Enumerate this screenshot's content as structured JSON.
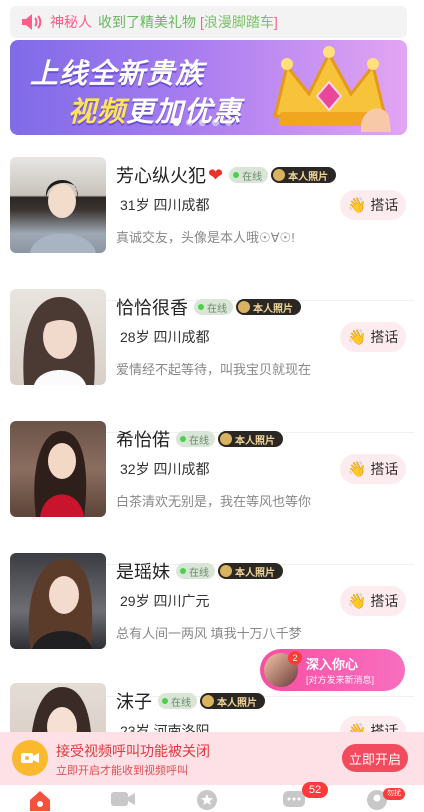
{
  "notice": {
    "icon": "speaker-icon",
    "sender": "神秘人",
    "action": "收到了精美礼物",
    "gift_open": "[",
    "gift": "浪漫脚踏车",
    "gift_close": "]"
  },
  "banner": {
    "line1": "上线全新贵族",
    "line2_highlight": "视频",
    "line2_rest": "更加优惠",
    "dots_count": 5,
    "active_dot": 1
  },
  "badges": {
    "online": "在线",
    "photo": "本人照片"
  },
  "chat_label": "搭话",
  "profiles": [
    {
      "name": "芳心纵火犯",
      "heart": true,
      "age": "31岁",
      "location": "四川成都",
      "bio": "真诚交友，头像是本人哦☉∀☉!"
    },
    {
      "name": "恰恰很香",
      "heart": false,
      "age": "28岁",
      "location": "四川成都",
      "bio": "爱情经不起等待，叫我宝贝就现在"
    },
    {
      "name": "希怡偌",
      "heart": false,
      "age": "32岁",
      "location": "四川成都",
      "bio": "白茶清欢无别是，我在等风也等你"
    },
    {
      "name": "是瑶妹",
      "heart": false,
      "age": "29岁",
      "location": "四川广元",
      "bio": "总有人间一两风 填我十万八千梦"
    },
    {
      "name": "沫子",
      "heart": false,
      "age": "23岁",
      "location": "河南洛阳",
      "bio": ""
    }
  ],
  "bubble": {
    "count": "2",
    "title": "深入你心",
    "subtitle": "[对方发来新消息]"
  },
  "callbar": {
    "title": "接受视频呼叫功能被关闭",
    "subtitle": "立即开启才能收到视频呼叫",
    "button": "立即开启"
  },
  "nav": {
    "message_badge": "52",
    "me_badge": "勿扰"
  },
  "colors": {
    "accent_pink": "#f24b5e",
    "online_green": "#4bd04b",
    "banner_purple": "#8b6fe8"
  }
}
